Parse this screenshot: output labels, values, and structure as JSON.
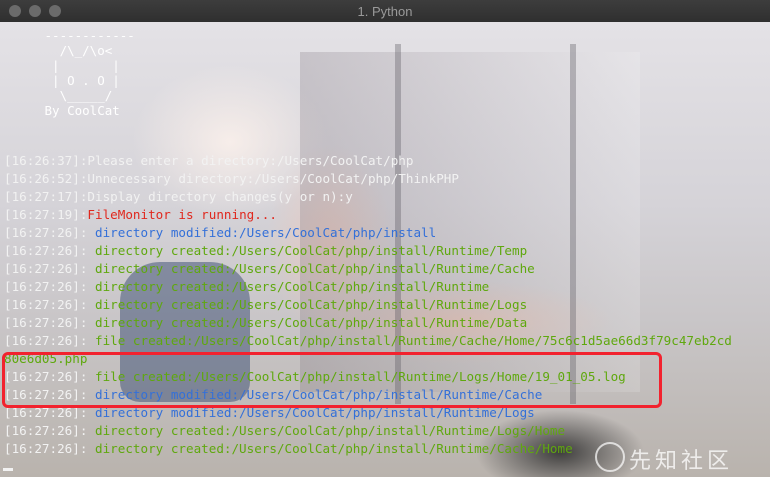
{
  "window": {
    "title": "1. Python"
  },
  "ascii_art": " ------------\n   /\\_/\\o<\n  |       |\n  | O . O |\n   \\_____/\n By CoolCat",
  "log": [
    {
      "ts": "[16:26:37]",
      "sep": ":",
      "text": "Please enter a directory:/Users/CoolCat/php",
      "color": "white"
    },
    {
      "ts": "[16:26:52]",
      "sep": ":",
      "text": "Unnecessary directory:/Users/CoolCat/php/ThinkPHP",
      "color": "white"
    },
    {
      "ts": "[16:27:17]",
      "sep": ":",
      "text": "Display directory changes(y or n):y",
      "color": "white"
    },
    {
      "ts": "[16:27:19]",
      "sep": ":",
      "text": "FileMonitor is running...",
      "color": "red"
    },
    {
      "ts": "[16:27:26]",
      "sep": ": ",
      "text": "directory modified:/Users/CoolCat/php/install",
      "color": "blue"
    },
    {
      "ts": "[16:27:26]",
      "sep": ": ",
      "text": "directory created:/Users/CoolCat/php/install/Runtime/Temp",
      "color": "green"
    },
    {
      "ts": "[16:27:26]",
      "sep": ": ",
      "text": "directory created:/Users/CoolCat/php/install/Runtime/Cache",
      "color": "green"
    },
    {
      "ts": "[16:27:26]",
      "sep": ": ",
      "text": "directory created:/Users/CoolCat/php/install/Runtime",
      "color": "green"
    },
    {
      "ts": "[16:27:26]",
      "sep": ": ",
      "text": "directory created:/Users/CoolCat/php/install/Runtime/Logs",
      "color": "green"
    },
    {
      "ts": "[16:27:26]",
      "sep": ": ",
      "text": "directory created:/Users/CoolCat/php/install/Runtime/Data",
      "color": "green"
    },
    {
      "ts": "[16:27:26]",
      "sep": ": ",
      "text": "file created:/Users/CoolCat/php/install/Runtime/Cache/Home/75c6c1d5ae66d3f79c47eb2cd",
      "color": "green"
    },
    {
      "ts": "",
      "sep": "",
      "text": "80e6d05.php",
      "color": "green"
    },
    {
      "ts": "[16:27:26]",
      "sep": ": ",
      "text": "file created:/Users/CoolCat/php/install/Runtime/Logs/Home/19_01_05.log",
      "color": "green"
    },
    {
      "ts": "[16:27:26]",
      "sep": ": ",
      "text": "directory modified:/Users/CoolCat/php/install/Runtime/Cache",
      "color": "blue"
    },
    {
      "ts": "[16:27:26]",
      "sep": ": ",
      "text": "directory modified:/Users/CoolCat/php/install/Runtime/Logs",
      "color": "blue"
    },
    {
      "ts": "[16:27:26]",
      "sep": ": ",
      "text": "directory created:/Users/CoolCat/php/install/Runtime/Logs/Home",
      "color": "green"
    },
    {
      "ts": "[16:27:26]",
      "sep": ": ",
      "text": "directory created:/Users/CoolCat/php/install/Runtime/Cache/Home",
      "color": "green"
    }
  ],
  "watermark": {
    "text": "先知社区"
  },
  "colors": {
    "red": "#e0281e",
    "blue": "#3470d8",
    "green": "#5fa80e",
    "highlight": "#f2222e"
  }
}
